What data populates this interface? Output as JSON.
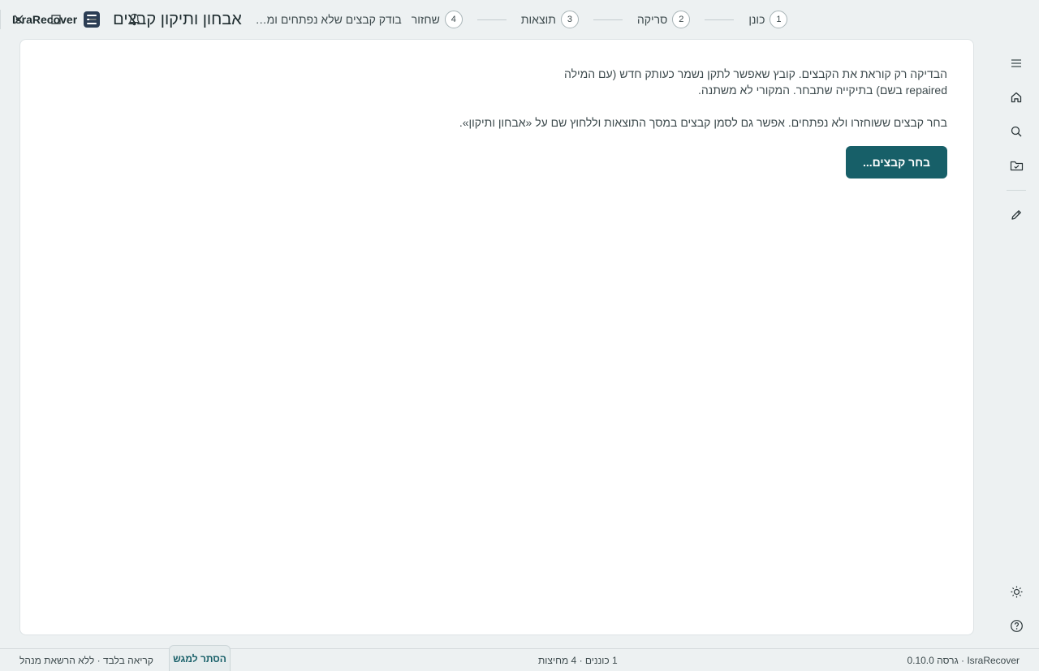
{
  "app": {
    "name": "IsraRecover",
    "title": "אבחון ותיקון קבצים",
    "subtitle": "בודק קבצים שלא נפתחים ומתקן..."
  },
  "stepper": {
    "steps": [
      {
        "num": "1",
        "label": "כונן"
      },
      {
        "num": "2",
        "label": "סריקה"
      },
      {
        "num": "3",
        "label": "תוצאות"
      },
      {
        "num": "4",
        "label": "שחזור"
      }
    ]
  },
  "window_controls": {
    "icons": [
      "bell-icon",
      "minimize-icon",
      "maximize-icon",
      "close-icon"
    ]
  },
  "main": {
    "desc1_line1": "הבדיקה רק קוראת את הקבצים. קובץ שאפשר לתקן נשמר כעותק חדש (עם המילה",
    "desc1_word": "repaired",
    "desc1_line2": "בשם) בתיקייה שתבחר. המקורי לא משתנה.",
    "desc2": "בחר קבצים ששוחזרו ולא נפתחים. אפשר גם לסמן קבצים במסך התוצאות וללחוץ שם על «אבחון ותיקון».",
    "select_button": "בחר קבצים..."
  },
  "rail": {
    "items": [
      {
        "name": "menu-icon"
      },
      {
        "name": "home-icon"
      },
      {
        "name": "search-icon"
      },
      {
        "name": "folder-check-icon"
      },
      {
        "name": "pencil-icon"
      },
      {
        "name": "theme-icon"
      },
      {
        "name": "help-icon"
      }
    ]
  },
  "status": {
    "version": "IsraRecover · גרסה 0.10.0",
    "drives": "1 כוננים · 4 מחיצות",
    "mode": "קריאה בלבד · ללא הרשאת מנהל",
    "touch_button": "הסתר למגש"
  },
  "colors": {
    "accent": "#175f68",
    "background": "#edf1f2",
    "card": "#ffffff",
    "logo": "#2b3d54"
  }
}
